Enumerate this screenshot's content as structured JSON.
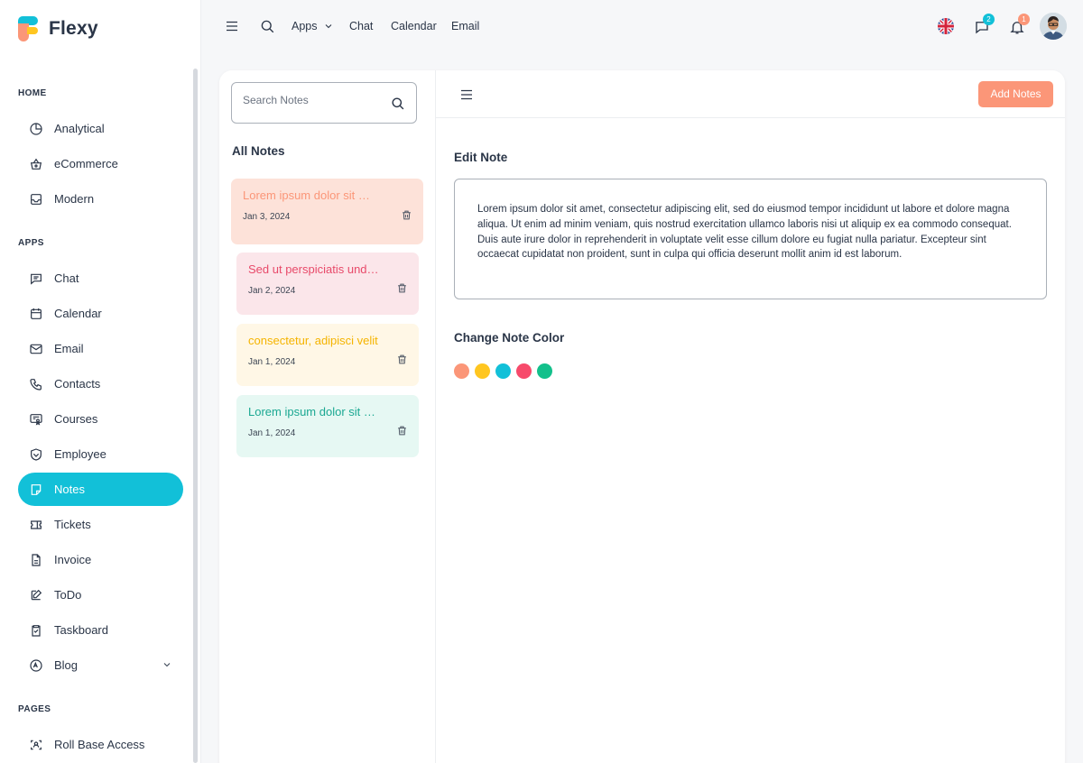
{
  "brand": {
    "name": "Flexy"
  },
  "sidebar": {
    "sections": [
      {
        "label": "HOME",
        "items": [
          {
            "label": "Analytical",
            "icon": "pie-chart-icon"
          },
          {
            "label": "eCommerce",
            "icon": "basket-icon"
          },
          {
            "label": "Modern",
            "icon": "inbox-icon"
          }
        ]
      },
      {
        "label": "APPS",
        "items": [
          {
            "label": "Chat",
            "icon": "message-icon"
          },
          {
            "label": "Calendar",
            "icon": "calendar-icon"
          },
          {
            "label": "Email",
            "icon": "mail-icon"
          },
          {
            "label": "Contacts",
            "icon": "phone-icon"
          },
          {
            "label": "Courses",
            "icon": "certificate-icon"
          },
          {
            "label": "Employee",
            "icon": "shield-icon"
          },
          {
            "label": "Notes",
            "icon": "note-icon",
            "active": true
          },
          {
            "label": "Tickets",
            "icon": "ticket-icon"
          },
          {
            "label": "Invoice",
            "icon": "file-icon"
          },
          {
            "label": "ToDo",
            "icon": "edit-icon"
          },
          {
            "label": "Taskboard",
            "icon": "clipboard-icon"
          },
          {
            "label": "Blog",
            "icon": "blog-icon",
            "has_chevron": true
          }
        ]
      },
      {
        "label": "PAGES",
        "items": [
          {
            "label": "Roll Base Access",
            "icon": "user-scan-icon"
          }
        ]
      }
    ]
  },
  "topbar": {
    "links": {
      "apps": "Apps",
      "chat": "Chat",
      "calendar": "Calendar",
      "email": "Email"
    },
    "messages_badge": "2",
    "notifications_badge": "1"
  },
  "notes": {
    "search_placeholder": "Search Notes",
    "heading": "All Notes",
    "items": [
      {
        "title": "Lorem ipsum dolor sit amet, consectetur",
        "date": "Jan 3, 2024",
        "text_color": "#fb9678",
        "bg": "#fde2d9"
      },
      {
        "title": "Sed ut perspiciatis unde omnis",
        "date": "Jan 2, 2024",
        "text_color": "#e84a6a",
        "bg": "#fbe6ea"
      },
      {
        "title": "consectetur, adipisci velit",
        "date": "Jan 1, 2024",
        "text_color": "#f5b400",
        "bg": "#fff7e6"
      },
      {
        "title": "Lorem ipsum dolor sit amet",
        "date": "Jan 1, 2024",
        "text_color": "#1ba892",
        "bg": "#e6f8f3"
      }
    ]
  },
  "editor": {
    "add_button": "Add Notes",
    "edit_label": "Edit Note",
    "content": "Lorem ipsum dolor sit amet, consectetur adipiscing elit, sed do eiusmod tempor incididunt ut labore et dolore magna aliqua. Ut enim ad minim veniam, quis nostrud exercitation ullamco laboris nisi ut aliquip ex ea commodo consequat. Duis aute irure dolor in reprehenderit in voluptate velit esse cillum dolore eu fugiat nulla pariatur. Excepteur sint occaecat cupidatat non proident, sunt in culpa qui officia deserunt mollit anim id est laborum.",
    "color_label": "Change Note Color",
    "colors": [
      "#fb9678",
      "#ffc620",
      "#12c0d8",
      "#f74a6b",
      "#13c08b"
    ]
  },
  "colors": {
    "accent": "#12c0d8",
    "primary_button": "#fb9678"
  }
}
